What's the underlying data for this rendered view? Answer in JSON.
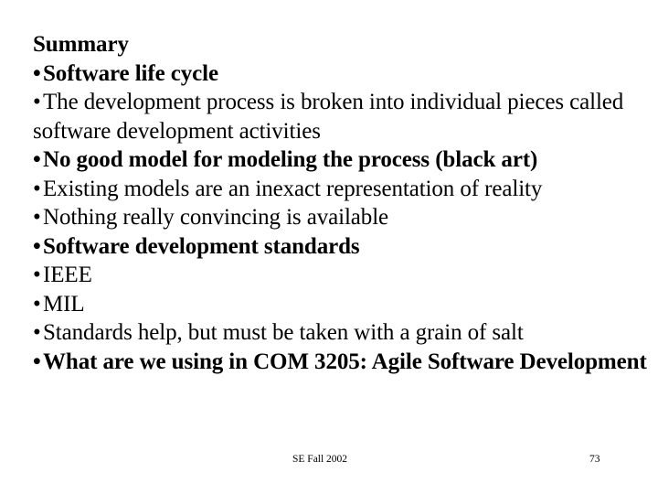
{
  "slide": {
    "background_color": "#ffffff",
    "text_color": "#000000",
    "title": "Summary",
    "bullet_glyph": "•",
    "lines": [
      {
        "text": "Summary",
        "bold": true,
        "bullet": false
      },
      {
        "text": "Software life cycle",
        "bold": true,
        "bullet": true
      },
      {
        "text": "The development process is broken into individual pieces called",
        "bold": false,
        "bullet": true
      },
      {
        "text": "software development activities",
        "bold": false,
        "bullet": false
      },
      {
        "text": "No good model for modeling the process (black art)",
        "bold": true,
        "bullet": true
      },
      {
        "text": "Existing models are an inexact representation of reality",
        "bold": false,
        "bullet": true
      },
      {
        "text": "Nothing really convincing is available",
        "bold": false,
        "bullet": true
      },
      {
        "text": "Software development standards",
        "bold": true,
        "bullet": true
      },
      {
        "text": "IEEE",
        "bold": false,
        "bullet": true
      },
      {
        "text": "MIL",
        "bold": false,
        "bullet": true
      },
      {
        "text": "Standards help, but must be taken with a grain of salt",
        "bold": false,
        "bullet": true
      },
      {
        "text": "What are we using in COM 3205: Agile Software Development",
        "bold": true,
        "bullet": true
      }
    ]
  },
  "footer": {
    "course_label": "SE Fall 2002",
    "page_number": "73"
  }
}
